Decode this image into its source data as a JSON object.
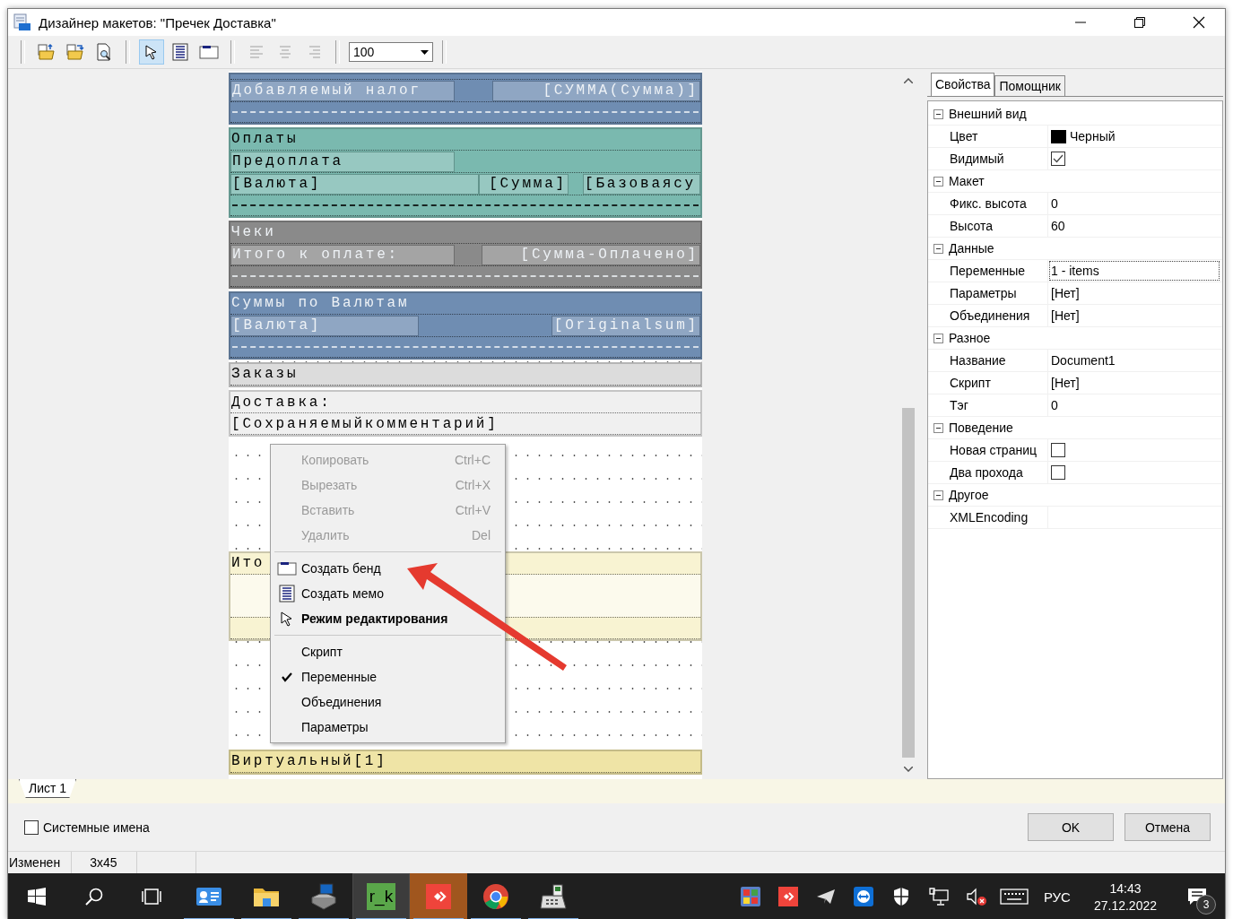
{
  "window": {
    "title": "Дизайнер макетов: \"Пречек Доставка\""
  },
  "toolbar": {
    "tools": [
      {
        "kind": "open",
        "selected": false,
        "disabled": false
      },
      {
        "kind": "save",
        "selected": false,
        "disabled": false
      },
      {
        "kind": "preview",
        "selected": false,
        "disabled": false
      },
      {
        "kind": "separator"
      },
      {
        "kind": "pointer",
        "selected": true,
        "disabled": false
      },
      {
        "kind": "memo",
        "selected": false,
        "disabled": false
      },
      {
        "kind": "band",
        "selected": false,
        "disabled": false
      },
      {
        "kind": "separator"
      },
      {
        "kind": "align-left",
        "selected": false,
        "disabled": true
      },
      {
        "kind": "align-center",
        "selected": false,
        "disabled": true
      },
      {
        "kind": "align-right",
        "selected": false,
        "disabled": true
      },
      {
        "kind": "separator"
      }
    ],
    "zoom": "100"
  },
  "designer": {
    "bands": [
      {
        "color": "#6f8db2",
        "rows": [
          {
            "kind": "stub",
            "cells": []
          },
          {
            "kind": "tax",
            "cells": [
              {
                "text": "Добавляемый налог"
              },
              {
                "text": "[СУММА(Сумма)]"
              }
            ]
          },
          {
            "kind": "dashes",
            "cells": []
          }
        ]
      },
      {
        "color": "#7ab9af",
        "title": "Оплаты",
        "rows": [
          {
            "kind": "prepay",
            "cells": [
              {
                "text": "Предоплата"
              }
            ]
          },
          {
            "kind": "payment",
            "cells": [
              {
                "text": "[Валюта]"
              },
              {
                "text": "[Сумма]"
              },
              {
                "text": "[Базоваясу"
              }
            ]
          },
          {
            "kind": "dashes",
            "cells": []
          }
        ]
      },
      {
        "color": "#8a8a8a",
        "title": "Чеки",
        "rows": [
          {
            "kind": "check",
            "cells": [
              {
                "text": "Итого к оплате:"
              },
              {
                "text": "[Сумма-Оплачено]"
              }
            ]
          },
          {
            "kind": "dashes",
            "cells": []
          }
        ]
      },
      {
        "color": "#6f8db2",
        "title": "Суммы по Валютам",
        "rows": [
          {
            "kind": "currency",
            "cells": [
              {
                "text": "[Валюта]"
              },
              {
                "text": "[Originalsum]"
              }
            ]
          },
          {
            "kind": "dashes",
            "cells": []
          }
        ]
      },
      {
        "color": "#dcdcdc",
        "title": "Заказы"
      },
      {
        "color": "#f0f0f0",
        "rows": [
          {
            "kind": "line",
            "cells": [
              {
                "text": "Доставка:"
              }
            ]
          },
          {
            "kind": "line",
            "cells": [
              {
                "text": "[Сохраняемыйкомментарий]"
              }
            ]
          }
        ]
      },
      {
        "kind": "space"
      },
      {
        "color": "#f8f3d2",
        "title": "Ито",
        "rows": [
          {
            "kind": "blank",
            "cells": []
          },
          {
            "kind": "plain",
            "cells": []
          }
        ]
      },
      {
        "kind": "space-fill"
      },
      {
        "color": "#efe4a6",
        "title": "Виртуальный[1]"
      }
    ]
  },
  "context_menu": {
    "items": [
      {
        "kind": "command",
        "label": "Копировать",
        "shortcut": "Ctrl+C",
        "disabled": true,
        "checked": false,
        "default": false
      },
      {
        "kind": "command",
        "label": "Вырезать",
        "shortcut": "Ctrl+X",
        "disabled": true,
        "checked": false,
        "default": false
      },
      {
        "kind": "command",
        "label": "Вставить",
        "shortcut": "Ctrl+V",
        "disabled": true,
        "checked": false,
        "default": false
      },
      {
        "kind": "command",
        "label": "Удалить",
        "shortcut": "Del",
        "disabled": true,
        "checked": false,
        "default": false
      },
      {
        "kind": "separator"
      },
      {
        "kind": "band",
        "label": "Создать бенд",
        "disabled": false,
        "checked": false,
        "default": false
      },
      {
        "kind": "memo",
        "label": "Создать мемо",
        "disabled": false,
        "checked": false,
        "default": false
      },
      {
        "kind": "pointer",
        "label": "Режим редактирования",
        "disabled": false,
        "checked": false,
        "default": true
      },
      {
        "kind": "separator"
      },
      {
        "kind": "command",
        "label": "Скрипт",
        "disabled": false,
        "checked": false,
        "default": false
      },
      {
        "kind": "command",
        "label": "Переменные",
        "disabled": false,
        "checked": true,
        "default": false
      },
      {
        "kind": "command",
        "label": "Объединения",
        "disabled": false,
        "checked": false,
        "default": false
      },
      {
        "kind": "command",
        "label": "Параметры",
        "disabled": false,
        "checked": false,
        "default": false
      }
    ]
  },
  "properties": {
    "tabs": [
      {
        "label": "Свойства",
        "selected": true
      },
      {
        "label": "Помощник",
        "selected": false
      }
    ],
    "groups": [
      {
        "label": "Внешний вид",
        "expanded": true,
        "rows": [
          {
            "kind": "color",
            "name": "Цвет",
            "value": "Черный",
            "color": "#000000",
            "selected": false
          },
          {
            "kind": "check",
            "name": "Видимый",
            "checked": true,
            "selected": false
          }
        ]
      },
      {
        "label": "Макет",
        "expanded": true,
        "rows": [
          {
            "kind": "text",
            "name": "Фикс. высота",
            "value": "0",
            "selected": false
          },
          {
            "kind": "text",
            "name": "Высота",
            "value": "60",
            "selected": false
          }
        ]
      },
      {
        "label": "Данные",
        "expanded": true,
        "rows": [
          {
            "kind": "text",
            "name": "Переменные",
            "value": "1 - items",
            "selected": true
          },
          {
            "kind": "text",
            "name": "Параметры",
            "value": "[Нет]",
            "selected": false
          },
          {
            "kind": "text",
            "name": "Объединения",
            "value": "[Нет]",
            "selected": false
          }
        ]
      },
      {
        "label": "Разное",
        "expanded": true,
        "rows": [
          {
            "kind": "text",
            "name": "Название",
            "value": "Document1",
            "selected": false
          },
          {
            "kind": "text",
            "name": "Скрипт",
            "value": "[Нет]",
            "selected": false
          },
          {
            "kind": "text",
            "name": "Тэг",
            "value": "0",
            "selected": false
          }
        ]
      },
      {
        "label": "Поведение",
        "expanded": true,
        "rows": [
          {
            "kind": "check",
            "name": "Новая страниц",
            "checked": false,
            "selected": false
          },
          {
            "kind": "check",
            "name": "Два прохода",
            "checked": false,
            "selected": false
          }
        ]
      },
      {
        "label": "Другое",
        "expanded": true,
        "rows": [
          {
            "kind": "text",
            "name": "XMLEncoding",
            "selected": false
          }
        ]
      }
    ]
  },
  "sheet_tabs": [
    {
      "label": "Лист 1",
      "selected": true
    }
  ],
  "system_names": {
    "label": "Системные имена",
    "checked": false
  },
  "buttons": [
    "OK",
    "Отмена"
  ],
  "status_bar": [
    "Изменен",
    "3x45"
  ],
  "taskbar": {
    "buttons": [
      {
        "kind": "start"
      },
      {
        "kind": "search"
      },
      {
        "kind": "task-view"
      },
      {
        "kind": "app-card",
        "running": true,
        "active": false,
        "flashing": false
      },
      {
        "kind": "folder",
        "running": true,
        "active": false,
        "flashing": false
      },
      {
        "kind": "network",
        "running": true,
        "active": false,
        "flashing": false
      },
      {
        "kind": "text-app",
        "label": "r_k",
        "running": true,
        "active": true,
        "flashing": false
      },
      {
        "kind": "remote",
        "running": true,
        "active": false,
        "flashing": true
      },
      {
        "kind": "browser",
        "running": true,
        "active": false,
        "flashing": false
      },
      {
        "kind": "register",
        "running": true,
        "active": false,
        "flashing": false
      }
    ],
    "tray": [
      {
        "kind": "colorful"
      },
      {
        "kind": "remote"
      },
      {
        "kind": "plane"
      },
      {
        "kind": "teamviewer"
      },
      {
        "kind": "shield"
      },
      {
        "kind": "network"
      },
      {
        "kind": "muted"
      },
      {
        "kind": "keyboard"
      }
    ],
    "language": "РУС",
    "time": "14:43",
    "date": "27.12.2022",
    "notifications": "3"
  }
}
